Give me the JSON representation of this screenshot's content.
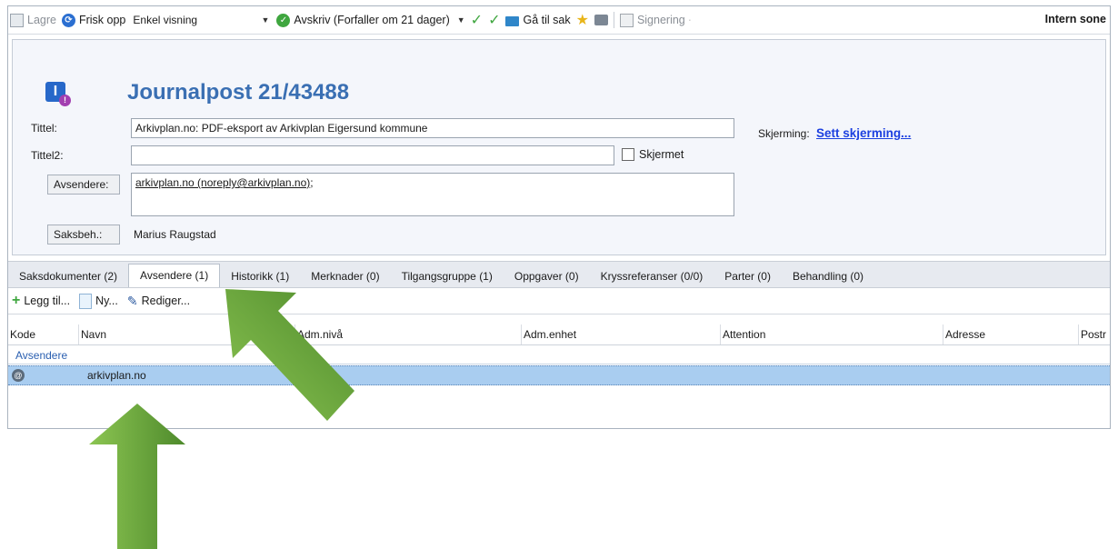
{
  "toolbar": {
    "save": "Lagre",
    "refresh": "Frisk opp",
    "view": "Enkel visning",
    "writeoff": "Avskriv (Forfaller om 21 dager)",
    "goto_case": "Gå til sak",
    "signing": "Signering",
    "zone": "Intern sone"
  },
  "header": {
    "title": "Journalpost 21/43488",
    "fields": {
      "tittel_label": "Tittel:",
      "tittel_value": "Arkivplan.no: PDF-eksport av Arkivplan Eigersund kommune",
      "tittel2_label": "Tittel2:",
      "tittel2_value": "",
      "skjermet_label": "Skjermet",
      "avsendere_button": "Avsendere:",
      "avsendere_value": "arkivplan.no (noreply@arkivplan.no)",
      "avsendere_suffix": ";",
      "saksbeh_button": "Saksbeh.:",
      "saksbeh_value": "Marius Raugstad",
      "skjerming_label": "Skjerming:",
      "skjerming_link": "Sett skjerming..."
    }
  },
  "tabs": [
    {
      "label": "Saksdokumenter (2)"
    },
    {
      "label": "Avsendere (1)"
    },
    {
      "label": "Historikk (1)"
    },
    {
      "label": "Merknader (0)"
    },
    {
      "label": "Tilgangsgruppe (1)"
    },
    {
      "label": "Oppgaver (0)"
    },
    {
      "label": "Kryssreferanser (0/0)"
    },
    {
      "label": "Parter (0)"
    },
    {
      "label": "Behandling (0)"
    }
  ],
  "subtoolbar": {
    "add": "Legg til...",
    "new": "Ny...",
    "edit": "Rediger..."
  },
  "grid": {
    "columns": [
      "Kode",
      "Navn",
      "Adm.nivå",
      "Adm.enhet",
      "Attention",
      "Adresse",
      "Postr"
    ],
    "group": "Avsendere",
    "rows": [
      {
        "name": "arkivplan.no"
      }
    ]
  },
  "colors": {
    "arrow": "#5f9a36",
    "title": "#3a6fb3",
    "selected_row": "#a9cdf0"
  }
}
